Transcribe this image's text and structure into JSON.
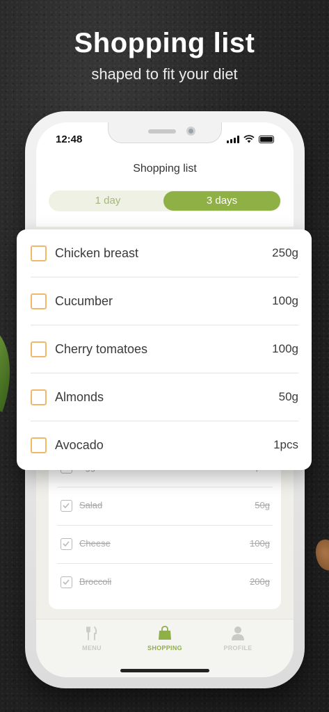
{
  "promo": {
    "headline": "Shopping list",
    "subline": "shaped to fit your diet"
  },
  "status": {
    "time": "12:48"
  },
  "screen": {
    "title": "Shopping list",
    "segments": [
      {
        "label": "1 day",
        "selected": false
      },
      {
        "label": "3 days",
        "selected": true
      }
    ]
  },
  "shopping_items": [
    {
      "name": "Chicken breast",
      "qty": "250g",
      "checked": false
    },
    {
      "name": "Cucumber",
      "qty": "100g",
      "checked": false
    },
    {
      "name": "Cherry tomatoes",
      "qty": "100g",
      "checked": false
    },
    {
      "name": "Almonds",
      "qty": "50g",
      "checked": false
    },
    {
      "name": "Avocado",
      "qty": "1pcs",
      "checked": false
    }
  ],
  "checked_items": [
    {
      "name": "Eggs",
      "qty": "10pcs",
      "checked": true
    },
    {
      "name": "Salad",
      "qty": "50g",
      "checked": true
    },
    {
      "name": "Cheese",
      "qty": "100g",
      "checked": true
    },
    {
      "name": "Broccoli",
      "qty": "200g",
      "checked": true
    }
  ],
  "tabs": [
    {
      "label": "MENU",
      "icon": "fork-knife-icon",
      "active": false
    },
    {
      "label": "SHOPPING",
      "icon": "shopping-bag-icon",
      "active": true
    },
    {
      "label": "PROFILE",
      "icon": "person-icon",
      "active": false
    }
  ],
  "colors": {
    "accent_green": "#8fb044",
    "checkbox_orange": "#f2b86a",
    "inactive_tab": "#c9c9c5"
  }
}
